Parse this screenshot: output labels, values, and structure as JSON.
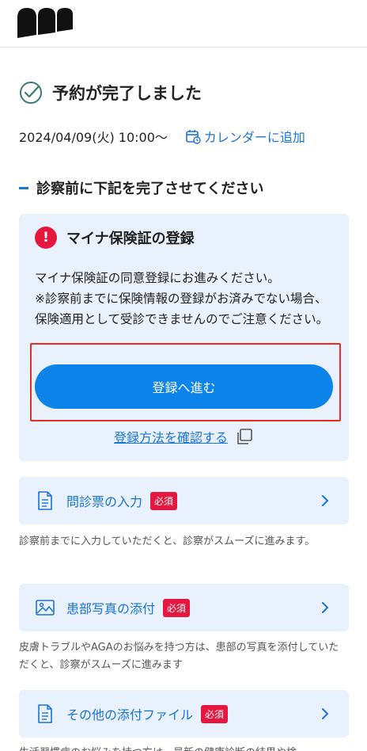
{
  "completion": {
    "title": "予約が完了しました",
    "datetime": "2024/04/09(火) 10:00〜",
    "calendar_link": "カレンダーに追加"
  },
  "section": {
    "title": "診察前に下記を完了させてください"
  },
  "myna": {
    "title": "マイナ保険証の登録",
    "alert_symbol": "!",
    "desc_line1": "マイナ保険証の同意登録にお進みください。",
    "desc_line2": "※診察前までに保険情報の登録がお済みでない場合、保険適用として受診できませんのでご注意ください。",
    "button": "登録へ進む",
    "howto_link": "登録方法を確認する"
  },
  "tasks": [
    {
      "label": "問診票の入力",
      "badge": "必須",
      "note": "診察前までに入力していただくと、診察がスムーズに進みます。"
    },
    {
      "label": "患部写真の添付",
      "badge": "必須",
      "note": "皮膚トラブルやAGAのお悩みを持つ方は、患部の写真を添付していただくと、診察がスムーズに進みます"
    },
    {
      "label": "その他の添付ファイル",
      "badge": "必須",
      "note": "生活習慣病のお悩みを持つ方は、最新の健康診断の結果や検"
    }
  ],
  "colors": {
    "accent": "#1a73d9",
    "button": "#0d84ea",
    "card_bg": "#e8f1fc",
    "required": "#e5173f",
    "highlight": "#e53020"
  }
}
